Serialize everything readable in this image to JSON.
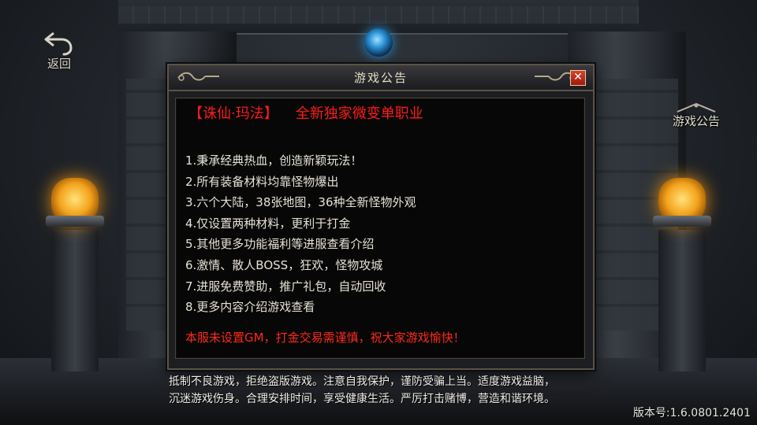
{
  "back": {
    "label": "返回",
    "icon": "back-arrow-icon"
  },
  "side_button": {
    "label": "游戏公告",
    "icon": "notice-ornament-icon"
  },
  "dialog": {
    "title": "游戏公告",
    "close_icon": "close-icon",
    "headline_left": "【诛仙·玛法】",
    "headline_right": "全新独家微变单职业",
    "items": [
      "1.秉承经典热血，创造新颖玩法！",
      "2.所有装备材料均靠怪物爆出",
      "3.六个大陆，38张地图，36种全新怪物外观",
      "4.仅设置两种材料，更利于打金",
      "5.其他更多功能福利等进服查看介绍",
      "6.激情、散人BOSS，狂欢，怪物攻城",
      "7.进服免费赞助，推广礼包，自动回收",
      "8.更多内容介绍游戏查看"
    ],
    "warning": "本服未设置GM，打金交易需谨慎，祝大家游戏愉快！"
  },
  "health_notice": {
    "line1": "抵制不良游戏，拒绝盗版游戏。注意自我保护，谨防受骗上当。适度游戏益脑，",
    "line2": "沉迷游戏伤身。合理安排时间，享受健康生活。严厉打击赌博，营造和谐环境。"
  },
  "version": "版本号:1.6.0801.2401",
  "colors": {
    "headline": "#ff1a1a",
    "warning": "#ff2a1a",
    "body_text": "#e6e1d6",
    "dialog_border": "#5b5347",
    "close_button": "#c6301f"
  }
}
